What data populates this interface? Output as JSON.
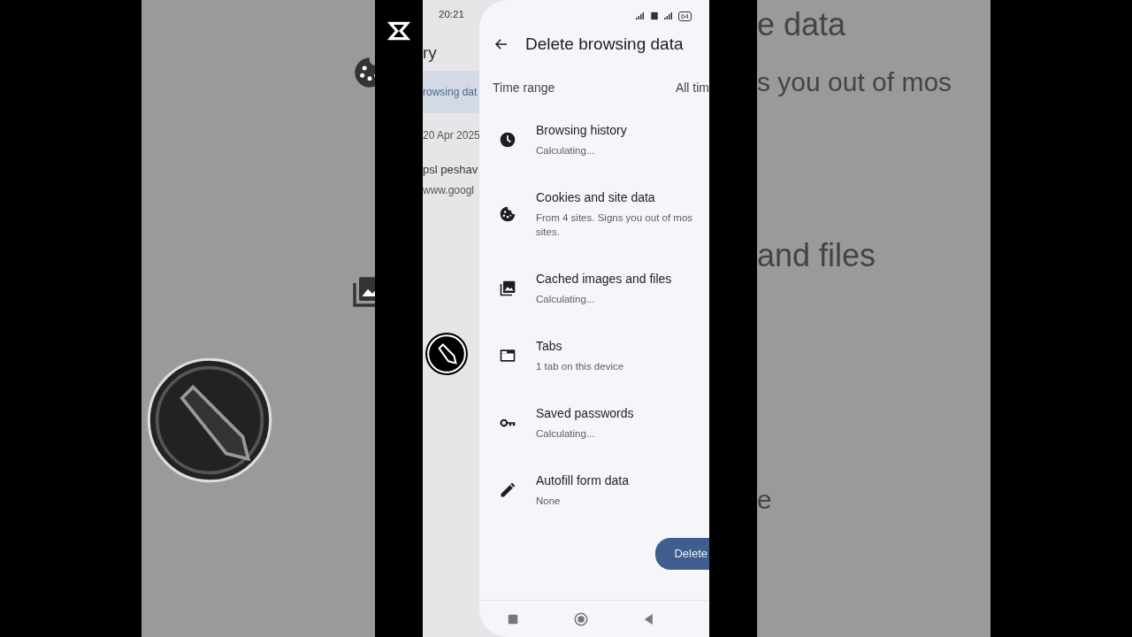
{
  "backdrop_right": [
    {
      "text": "e data"
    },
    {
      "text": "s you out of mos"
    },
    {
      "text": "and files"
    },
    {
      "text": "e"
    }
  ],
  "status_bar": {
    "time": "20:21",
    "battery": "64"
  },
  "history_page": {
    "title": "ry",
    "selected_item": "rowsing dat",
    "date": "20 Apr 2025",
    "entries": [
      {
        "title": "psl peshav",
        "url": "www.googl"
      }
    ]
  },
  "sheet": {
    "title": "Delete browsing data",
    "time_range": {
      "label": "Time range",
      "value": "All tim"
    },
    "items": [
      {
        "kind": "history",
        "title": "Browsing history",
        "subtitle": "Calculating..."
      },
      {
        "kind": "cookies",
        "title": "Cookies and site data",
        "subtitle": "From 4 sites. Signs you out of mos\nsites."
      },
      {
        "kind": "cache",
        "title": "Cached images and files",
        "subtitle": "Calculating..."
      },
      {
        "kind": "tabs",
        "title": "Tabs",
        "subtitle": "1 tab on this device"
      },
      {
        "kind": "passwords",
        "title": "Saved passwords",
        "subtitle": "Calculating..."
      },
      {
        "kind": "autofill",
        "title": "Autofill form data",
        "subtitle": "None"
      }
    ],
    "button": "Delete"
  }
}
